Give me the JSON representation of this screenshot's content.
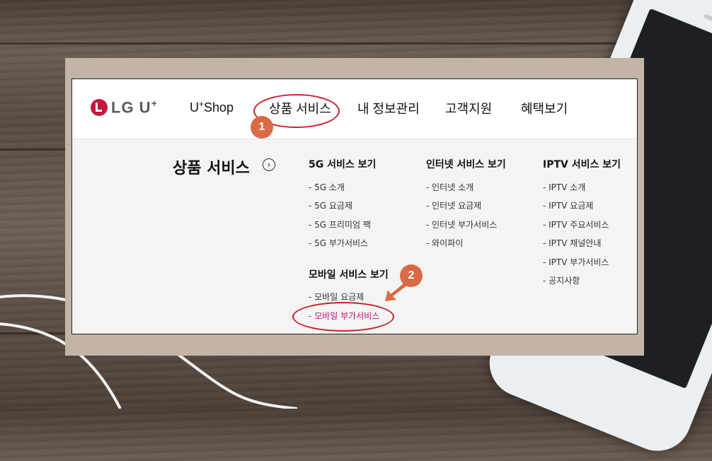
{
  "logo": {
    "text": "LG U",
    "sup": "+"
  },
  "nav": {
    "items": [
      {
        "label": "U"
      },
      {
        "label": "상품 서비스"
      },
      {
        "label": "내 정보관리"
      },
      {
        "label": "고객지원"
      },
      {
        "label": "혜택보기"
      }
    ],
    "ushop_sup": "+",
    "ushop_rest": "Shop"
  },
  "annotations": {
    "step1": "1",
    "step2": "2"
  },
  "section": {
    "title": "상품 서비스",
    "arrow": "›"
  },
  "columns": {
    "fiveg": {
      "title": "5G 서비스 보기",
      "items": [
        "- 5G 소개",
        "- 5G 요금제",
        "- 5G 프리미엄 팩",
        "- 5G 부가서비스"
      ]
    },
    "mobile": {
      "title": "모바일 서비스 보기",
      "items": [
        "- 모바일 요금제",
        "- 모바일 부가서비스"
      ]
    },
    "internet": {
      "title": "인터넷 서비스 보기",
      "items": [
        "- 인터넷 소개",
        "- 인터넷 요금제",
        "- 인터넷 부가서비스",
        "- 와이파이"
      ]
    },
    "iptv": {
      "title": "IPTV 서비스 보기",
      "items": [
        "- IPTV 소개",
        "- IPTV 요금제",
        "- IPTV 주요서비스",
        "- IPTV 채널안내",
        "- IPTV 부가서비스",
        "- 공지사항"
      ]
    }
  },
  "colors": {
    "accent_red": "#c8212f",
    "badge": "#d86b45",
    "active_link": "#c4127a",
    "logo_red": "#c6173f"
  }
}
